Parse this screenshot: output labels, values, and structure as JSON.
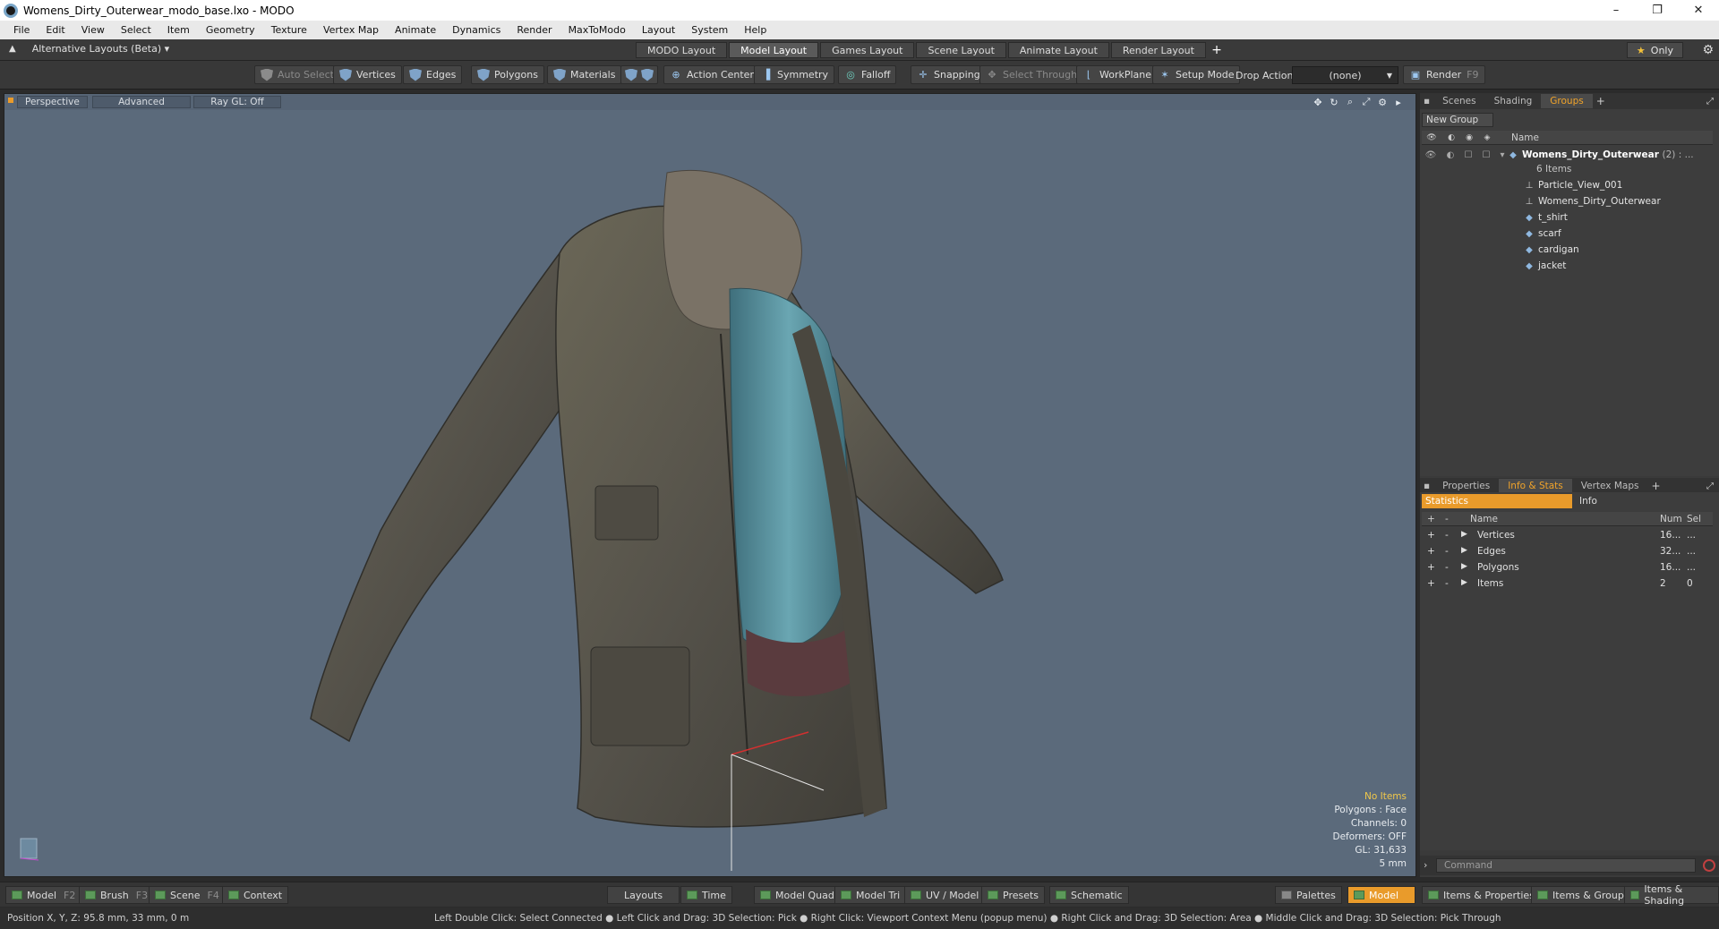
{
  "window": {
    "title": "Womens_Dirty_Outerwear_modo_base.lxo - MODO",
    "minimize": "–",
    "maximize": "❐",
    "close": "✕"
  },
  "menu": [
    "File",
    "Edit",
    "View",
    "Select",
    "Item",
    "Geometry",
    "Texture",
    "Vertex Map",
    "Animate",
    "Dynamics",
    "Render",
    "MaxToModo",
    "Layout",
    "System",
    "Help"
  ],
  "layoutbar": {
    "alt_layouts": "Alternative Layouts (Beta) ▾",
    "tabs": [
      "MODO Layout",
      "Model Layout",
      "Games Layout",
      "Scene Layout",
      "Animate Layout",
      "Render Layout"
    ],
    "active_tab": "Model Layout",
    "add": "+",
    "only": "Only"
  },
  "toolbar": {
    "auto_select": "Auto Select",
    "vertices": "Vertices",
    "edges": "Edges",
    "polygons": "Polygons",
    "materials": "Materials",
    "action_center": "Action Center",
    "symmetry": "Symmetry",
    "falloff": "Falloff",
    "snapping": "Snapping",
    "select_through": "Select Through",
    "workplane": "WorkPlane",
    "setup_mode": "Setup Mode",
    "drop_action": "Drop Action",
    "drop_value": "(none)",
    "render": "Render",
    "render_key": "F9"
  },
  "viewport": {
    "perspective": "Perspective",
    "advanced": "Advanced",
    "raygl": "Ray GL: Off",
    "info": {
      "no_items": "No Items",
      "polygons": "Polygons : Face",
      "channels": "Channels: 0",
      "deformers": "Deformers: OFF",
      "gl": "GL: 31,633",
      "scale": "5 mm"
    }
  },
  "groups_panel": {
    "tabs": [
      "Scenes",
      "Shading",
      "Groups"
    ],
    "active_tab": "Groups",
    "new_group": "New Group",
    "name_col": "Name",
    "root": {
      "name": "Womens_Dirty_Outerwear",
      "count": "(2) : ...",
      "sub": "6 Items"
    },
    "items": [
      "Particle_View_001",
      "Womens_Dirty_Outerwear",
      "t_shirt",
      "scarf",
      "cardigan",
      "jacket"
    ]
  },
  "stats_panel": {
    "tabs": [
      "Properties",
      "Info & Stats",
      "Vertex Maps"
    ],
    "active_tab": "Info & Stats",
    "statistics": "Statistics",
    "info": "Info",
    "columns": {
      "name": "Name",
      "num": "Num",
      "sel": "Sel"
    },
    "rows": [
      {
        "name": "Vertices",
        "num": "16...",
        "sel": "..."
      },
      {
        "name": "Edges",
        "num": "32...",
        "sel": "..."
      },
      {
        "name": "Polygons",
        "num": "16...",
        "sel": "..."
      },
      {
        "name": "Items",
        "num": "2",
        "sel": "0"
      }
    ],
    "command_placeholder": "Command"
  },
  "bottombar": {
    "model": "Model",
    "model_key": "F2",
    "brush": "Brush",
    "brush_key": "F3",
    "scene": "Scene",
    "scene_key": "F4",
    "context": "Context",
    "layouts": "Layouts",
    "time": "Time",
    "model_quad": "Model Quad",
    "model_tri": "Model Tri",
    "uv_model": "UV / Model",
    "presets": "Presets",
    "schematic": "Schematic",
    "palettes": "Palettes",
    "model_active": "Model",
    "items_properties": "Items & Properties",
    "items_groups": "Items & Groups",
    "items_shading": "Items & Shading"
  },
  "status": {
    "position": "Position X, Y, Z:   95.8 mm, 33 mm, 0 m",
    "hint": "Left Double Click: Select Connected ● Left Click and Drag: 3D Selection: Pick ● Right Click: Viewport Context Menu (popup menu) ● Right Click and Drag: 3D Selection: Area ● Middle Click and Drag: 3D Selection: Pick Through"
  },
  "colors": {
    "accent": "#e99b2b",
    "viewport_bg": "#5b6a7b",
    "panel_bg": "#3d3d3d"
  }
}
